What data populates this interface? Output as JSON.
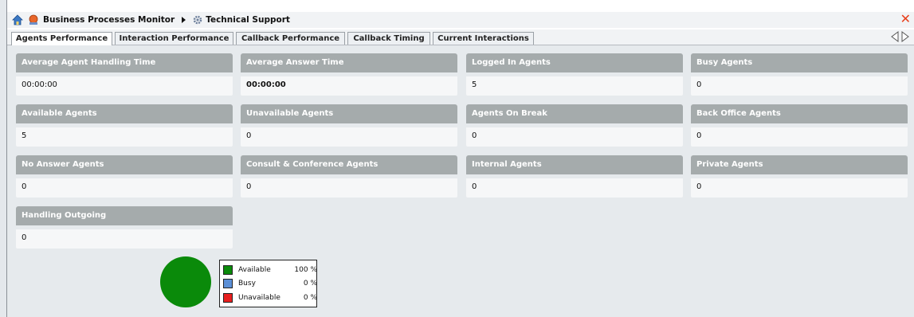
{
  "breadcrumb": {
    "root": "Business Processes Monitor",
    "current": "Technical Support"
  },
  "tabs": [
    {
      "label": "Agents Performance",
      "active": true
    },
    {
      "label": "Interaction Performance",
      "active": false
    },
    {
      "label": "Callback Performance",
      "active": false
    },
    {
      "label": "Callback Timing",
      "active": false
    },
    {
      "label": "Current Interactions",
      "active": false
    }
  ],
  "close_icon_color": "#e8401c",
  "cards": [
    {
      "title": "Average Agent Handling Time",
      "value": "00:00:00"
    },
    {
      "title": "Average Answer Time",
      "value": "00:00:00",
      "bold": true
    },
    {
      "title": "Logged In Agents",
      "value": "5"
    },
    {
      "title": "Busy Agents",
      "value": "0"
    },
    {
      "title": "Available Agents",
      "value": "5"
    },
    {
      "title": "Unavailable Agents",
      "value": "0"
    },
    {
      "title": "Agents On Break",
      "value": "0"
    },
    {
      "title": "Back Office Agents",
      "value": "0"
    },
    {
      "title": "No Answer Agents",
      "value": "0"
    },
    {
      "title": "Consult & Conference Agents",
      "value": "0"
    },
    {
      "title": "Internal Agents",
      "value": "0"
    },
    {
      "title": "Private Agents",
      "value": "0"
    },
    {
      "title": "Handling Outgoing",
      "value": "0"
    }
  ],
  "chart_data": {
    "type": "pie",
    "categories": [
      "Available",
      "Busy",
      "Unavailable"
    ],
    "values": [
      100,
      0,
      0
    ],
    "labels": [
      "100 %",
      "0 %",
      "0 %"
    ],
    "colors": [
      "#0a8a0a",
      "#5b8fd6",
      "#e81f1f"
    ],
    "legend": "right"
  }
}
